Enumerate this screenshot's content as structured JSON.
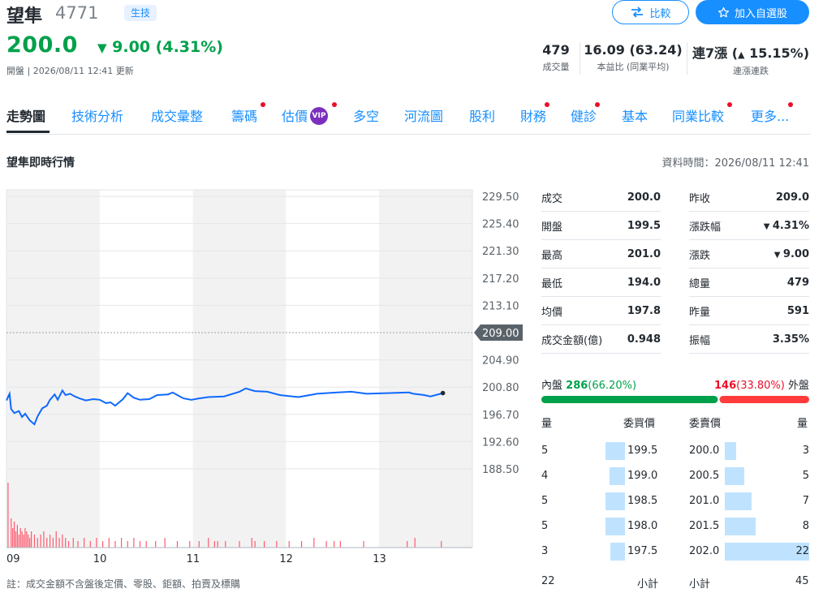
{
  "header": {
    "name": "望隼",
    "code": "4771",
    "industry": "生技",
    "price": "200.0",
    "change": "9.00 (4.31%)",
    "market_status": "開盤 | 2026/08/11 12:41 更新",
    "compare_label": "比較",
    "watchlist_label": "加入自選股"
  },
  "stats": {
    "volume": {
      "value": "479",
      "label": "成交量"
    },
    "pe": {
      "value": "16.09 (63.24)",
      "label": "本益比 (同業平均)"
    },
    "streak": {
      "value_prefix": "連7漲 (",
      "value_pct": "15.15%",
      "value_suffix": ")",
      "label": "連漲連跌"
    }
  },
  "tabs": [
    {
      "label": "走勢圖",
      "active": true,
      "dot": false
    },
    {
      "label": "技術分析",
      "dot": false
    },
    {
      "label": "成交彙整",
      "dot": false
    },
    {
      "label": "籌碼",
      "dot": true
    },
    {
      "label": "估價",
      "dot": true,
      "vip": "VIP"
    },
    {
      "label": "多空",
      "dot": false
    },
    {
      "label": "河流圖",
      "dot": false
    },
    {
      "label": "股利",
      "dot": false
    },
    {
      "label": "財務",
      "dot": true
    },
    {
      "label": "健診",
      "dot": true
    },
    {
      "label": "基本",
      "dot": false
    },
    {
      "label": "同業比較",
      "dot": true
    },
    {
      "label": "更多...",
      "dot": true
    }
  ],
  "section": {
    "title": "望隼即時行情",
    "data_time": "資料時間：2026/08/11 12:41"
  },
  "chart_data": {
    "type": "line",
    "y_ticks": [
      "229.50",
      "225.40",
      "221.30",
      "217.20",
      "213.10",
      "209.00",
      "204.90",
      "200.80",
      "196.70",
      "192.60",
      "188.50"
    ],
    "ylim": [
      188.5,
      229.5
    ],
    "reference_price": 209.0,
    "reference_label": "209.00",
    "x_ticks": [
      "09",
      "10",
      "11",
      "12",
      "13"
    ],
    "x_range_minutes": [
      0,
      270
    ],
    "price_series": [
      [
        0,
        198.8
      ],
      [
        2,
        199.8
      ],
      [
        3,
        197.5
      ],
      [
        5,
        196.9
      ],
      [
        8,
        197.2
      ],
      [
        10,
        196.3
      ],
      [
        12,
        196.8
      ],
      [
        15,
        195.8
      ],
      [
        18,
        195.2
      ],
      [
        20,
        196.4
      ],
      [
        23,
        197.6
      ],
      [
        26,
        198.0
      ],
      [
        28,
        198.9
      ],
      [
        31,
        199.7
      ],
      [
        33,
        198.9
      ],
      [
        36,
        200.3
      ],
      [
        38,
        199.6
      ],
      [
        41,
        199.8
      ],
      [
        44,
        199.4
      ],
      [
        47,
        199.1
      ],
      [
        51,
        198.8
      ],
      [
        56,
        199.0
      ],
      [
        60,
        198.9
      ],
      [
        64,
        198.4
      ],
      [
        67,
        198.5
      ],
      [
        70,
        198.0
      ],
      [
        75,
        199.0
      ],
      [
        78,
        199.9
      ],
      [
        82,
        199.2
      ],
      [
        86,
        198.9
      ],
      [
        92,
        199.0
      ],
      [
        97,
        199.6
      ],
      [
        104,
        199.7
      ],
      [
        107,
        200.0
      ],
      [
        110,
        199.6
      ],
      [
        114,
        199.1
      ],
      [
        119,
        198.9
      ],
      [
        124,
        199.1
      ],
      [
        130,
        199.3
      ],
      [
        140,
        199.4
      ],
      [
        150,
        200.1
      ],
      [
        154,
        200.6
      ],
      [
        160,
        200.2
      ],
      [
        168,
        200.1
      ],
      [
        176,
        199.6
      ],
      [
        188,
        199.3
      ],
      [
        200,
        199.8
      ],
      [
        213,
        200.0
      ],
      [
        222,
        200.1
      ],
      [
        232,
        199.8
      ],
      [
        245,
        199.9
      ],
      [
        259,
        200.0
      ],
      [
        262,
        199.8
      ],
      [
        269,
        199.6
      ],
      [
        273,
        199.4
      ],
      [
        281,
        199.9
      ]
    ],
    "last_point": [
      281,
      199.9
    ],
    "volume_series": [
      [
        1,
        20
      ],
      [
        3,
        9
      ],
      [
        4,
        6
      ],
      [
        5,
        8
      ],
      [
        6,
        5
      ],
      [
        7,
        7
      ],
      [
        8,
        4
      ],
      [
        9,
        6
      ],
      [
        10,
        5
      ],
      [
        11,
        4
      ],
      [
        12,
        6
      ],
      [
        13,
        5
      ],
      [
        14,
        4
      ],
      [
        15,
        3
      ],
      [
        16,
        5
      ],
      [
        18,
        4
      ],
      [
        20,
        3
      ],
      [
        22,
        4
      ],
      [
        24,
        5
      ],
      [
        26,
        3
      ],
      [
        28,
        4
      ],
      [
        30,
        3
      ],
      [
        32,
        5
      ],
      [
        34,
        3
      ],
      [
        36,
        4
      ],
      [
        38,
        3
      ],
      [
        40,
        2
      ],
      [
        43,
        3
      ],
      [
        46,
        2
      ],
      [
        50,
        3
      ],
      [
        54,
        2
      ],
      [
        58,
        3
      ],
      [
        62,
        2
      ],
      [
        66,
        3
      ],
      [
        70,
        2
      ],
      [
        74,
        3
      ],
      [
        78,
        2
      ],
      [
        82,
        3
      ],
      [
        86,
        2
      ],
      [
        90,
        2
      ],
      [
        96,
        2
      ],
      [
        102,
        3
      ],
      [
        110,
        2
      ],
      [
        118,
        2
      ],
      [
        124,
        2
      ],
      [
        130,
        3
      ],
      [
        134,
        2
      ],
      [
        136,
        2
      ],
      [
        141,
        2
      ],
      [
        150,
        2
      ],
      [
        158,
        3
      ],
      [
        160,
        2
      ],
      [
        166,
        2
      ],
      [
        174,
        2
      ],
      [
        182,
        2
      ],
      [
        190,
        2
      ],
      [
        198,
        3
      ],
      [
        206,
        2
      ],
      [
        211,
        2
      ],
      [
        215,
        2
      ],
      [
        230,
        2
      ],
      [
        258,
        2
      ],
      [
        263,
        3
      ],
      [
        280,
        2
      ]
    ]
  },
  "quote": {
    "left": [
      {
        "label": "成交",
        "value": "200.0",
        "color": "green"
      },
      {
        "label": "開盤",
        "value": "199.5",
        "color": "green"
      },
      {
        "label": "最高",
        "value": "201.0",
        "color": "green"
      },
      {
        "label": "最低",
        "value": "194.0",
        "color": "green"
      },
      {
        "label": "均價",
        "value": "197.8",
        "color": "normal"
      },
      {
        "label": "成交金額(億)",
        "value": "0.948",
        "color": "normal"
      }
    ],
    "right": [
      {
        "label": "昨收",
        "value": "209.0",
        "color": "normal"
      },
      {
        "label": "漲跌幅",
        "value": "4.31%",
        "color": "green",
        "arrow": "down"
      },
      {
        "label": "漲跌",
        "value": "9.00",
        "color": "green",
        "arrow": "down"
      },
      {
        "label": "總量",
        "value": "479",
        "color": "normal"
      },
      {
        "label": "昨量",
        "value": "591",
        "color": "normal"
      },
      {
        "label": "振幅",
        "value": "3.35%",
        "color": "normal"
      }
    ]
  },
  "inner_outer": {
    "inner_label": "內盤",
    "inner_value": "286",
    "inner_pct": "(66.20%)",
    "outer_value": "146",
    "outer_pct": "(33.80%)",
    "outer_label": "外盤",
    "inner_fraction": 0.662
  },
  "order_book": {
    "headers": {
      "bid_qty": "量",
      "bid_price": "委買價",
      "ask_price": "委賣價",
      "ask_qty": "量"
    },
    "bids": [
      {
        "qty": "5",
        "price": "199.5",
        "fill": 0.227
      },
      {
        "qty": "4",
        "price": "199.0",
        "fill": 0.182
      },
      {
        "qty": "5",
        "price": "198.5",
        "fill": 0.227
      },
      {
        "qty": "5",
        "price": "198.0",
        "fill": 0.227
      },
      {
        "qty": "3",
        "price": "197.5",
        "fill": 0.136
      }
    ],
    "asks": [
      {
        "price": "200.0",
        "qty": "3",
        "fill": 0.136
      },
      {
        "price": "200.5",
        "qty": "5",
        "fill": 0.227
      },
      {
        "price": "201.0",
        "qty": "7",
        "fill": 0.318
      },
      {
        "price": "201.5",
        "qty": "8",
        "fill": 0.364
      },
      {
        "price": "202.0",
        "qty": "22",
        "fill": 1.0
      }
    ],
    "bid_total": "22",
    "bid_total_label": "小計",
    "ask_total_label": "小計",
    "ask_total": "45"
  },
  "note": "註：成交金額不含盤後定價、零股、鉅額、拍賣及標購",
  "colors": {
    "up": "#eb0f29",
    "down": "#00a14b",
    "accent": "#188fff",
    "line": "#0f69ff",
    "volume": "#ff5a6e"
  }
}
